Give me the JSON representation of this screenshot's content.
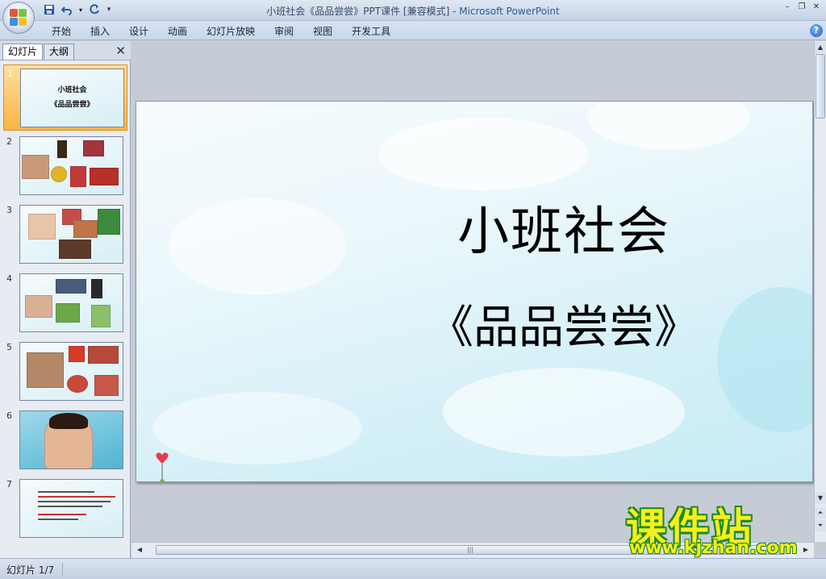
{
  "window": {
    "title_doc": "小班社会《品品尝尝》PPT课件 [兼容模式] - ",
    "title_app": "Microsoft PowerPoint",
    "min": "–",
    "restore": "❐",
    "close": "✕"
  },
  "quick_access": {
    "save": "save-icon",
    "undo": "undo-icon",
    "redo": "redo-icon",
    "customize": "▾"
  },
  "ribbon": {
    "tabs": [
      "开始",
      "插入",
      "设计",
      "动画",
      "幻灯片放映",
      "审阅",
      "视图",
      "开发工具"
    ],
    "help": "?"
  },
  "pane": {
    "tab_slides": "幻灯片",
    "tab_outline": "大纲",
    "close": "✕",
    "thumbnails": [
      {
        "num": "1",
        "title": "小班社会",
        "subtitle": "《品品尝尝》",
        "selected": true
      },
      {
        "num": "2"
      },
      {
        "num": "3"
      },
      {
        "num": "4"
      },
      {
        "num": "5"
      },
      {
        "num": "6"
      },
      {
        "num": "7"
      }
    ]
  },
  "slide": {
    "title": "小班社会",
    "subtitle": "《品品尝尝》"
  },
  "watermark": {
    "title": "课件站",
    "url": "www.kjzhan.com"
  },
  "status": {
    "text": "幻灯片 1/7"
  },
  "colors": {
    "ribbon": "#c9d6e8",
    "selection": "#f7b544",
    "slide_bg": "#d5f0f7",
    "watermark_fill": "#f7ef1a",
    "watermark_stroke": "#1d8a1d"
  }
}
